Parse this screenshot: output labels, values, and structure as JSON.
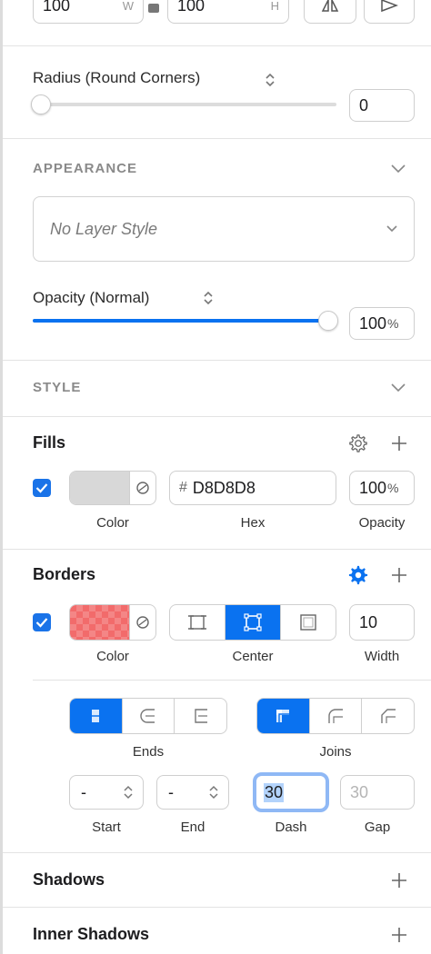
{
  "size": {
    "width_value": "100",
    "width_unit": "W",
    "height_value": "100",
    "height_unit": "H"
  },
  "radius": {
    "label": "Radius (Round Corners)",
    "value": "0"
  },
  "appearance": {
    "header": "APPEARANCE",
    "layer_style": "No Layer Style",
    "opacity_label": "Opacity (Normal)",
    "opacity_value": "100",
    "opacity_unit": "%",
    "opacity_level": 1.0
  },
  "style": {
    "header": "STYLE"
  },
  "fills": {
    "title": "Fills",
    "enabled": true,
    "color_hex": "#D8D8D8",
    "hex_prefix": "#",
    "hex_value": "D8D8D8",
    "opacity_value": "100",
    "opacity_unit": "%",
    "color_label": "Color",
    "hex_label": "Hex",
    "opacity_label": "Opacity"
  },
  "borders": {
    "title": "Borders",
    "enabled": true,
    "color_hex": "#F26B6B",
    "position_selected": "Center",
    "width_value": "10",
    "color_label": "Color",
    "position_label": "Center",
    "width_label": "Width"
  },
  "dash_options": {
    "ends_label": "Ends",
    "joins_label": "Joins",
    "start_value": "-",
    "end_value": "-",
    "dash_value": "30",
    "gap_placeholder": "30",
    "start_label": "Start",
    "end_label": "End",
    "dash_label": "Dash",
    "gap_label": "Gap"
  },
  "shadows": {
    "title": "Shadows"
  },
  "inner_shadows": {
    "title": "Inner Shadows"
  },
  "colors": {
    "accent": "#0A72F0",
    "checkbox": "#1A73E8"
  }
}
